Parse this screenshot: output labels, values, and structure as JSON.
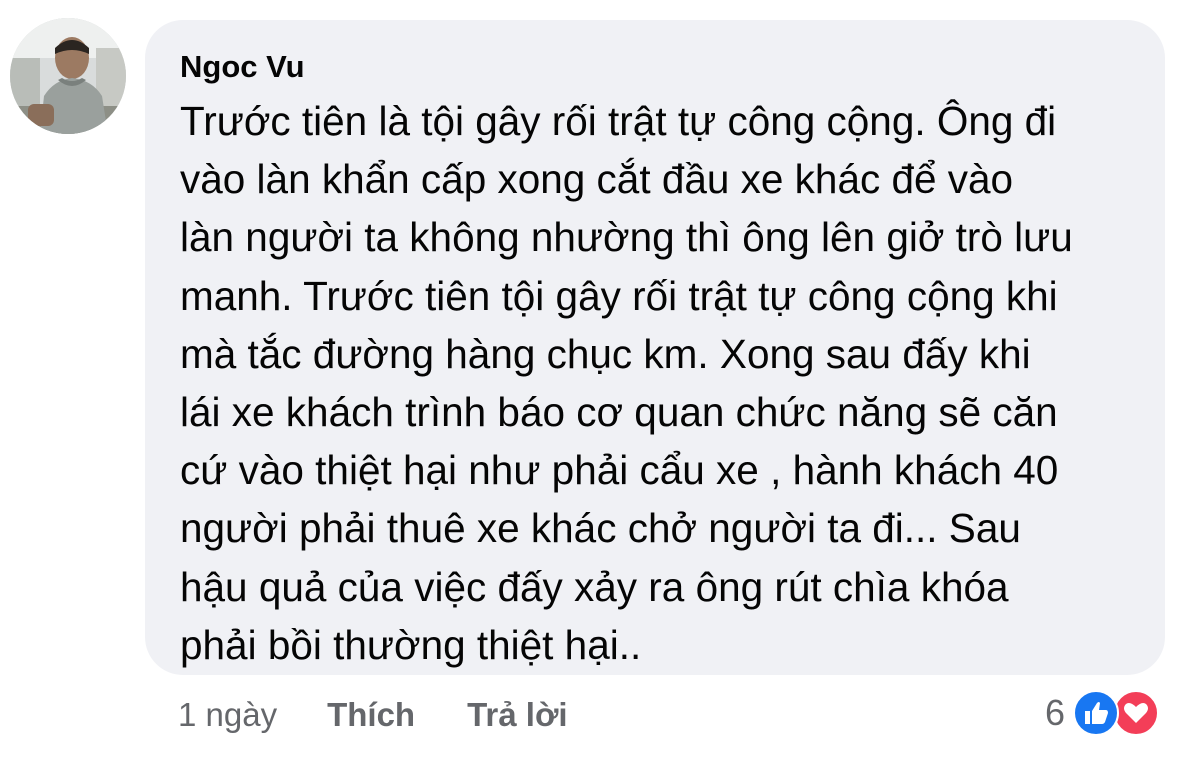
{
  "comment": {
    "author": "Ngoc Vu",
    "text_lines": [
      "Trước tiên là tội gây rối trật tự công cộng. Ông đi",
      "vào làn khẩn cấp xong cắt đầu xe khác để vào",
      "làn người ta không nhường thì ông lên giở trò lưu",
      "manh. Trước tiên tội gây rối trật tự công cộng khi",
      "mà tắc đường hàng chục km. Xong sau đấy khi",
      "lái xe khách trình báo cơ quan chức năng sẽ căn",
      "cứ vào thiệt hại như phải cẩu xe , hành khách 40",
      "người phải thuê xe khác chở người ta đi... Sau",
      "hậu quả của việc đấy xảy ra ông rút chìa khóa",
      "phải bồi thường thiệt hại.."
    ],
    "timestamp": "1 ngày",
    "like_label": "Thích",
    "reply_label": "Trả lời",
    "reaction_count": "6",
    "reaction_icons": [
      "like-icon",
      "love-icon"
    ]
  },
  "colors": {
    "bubble_bg": "#f0f1f5",
    "text": "#050505",
    "meta_text": "#65676b",
    "like_blue": "#1877f2",
    "love_red": "#f33e58"
  }
}
